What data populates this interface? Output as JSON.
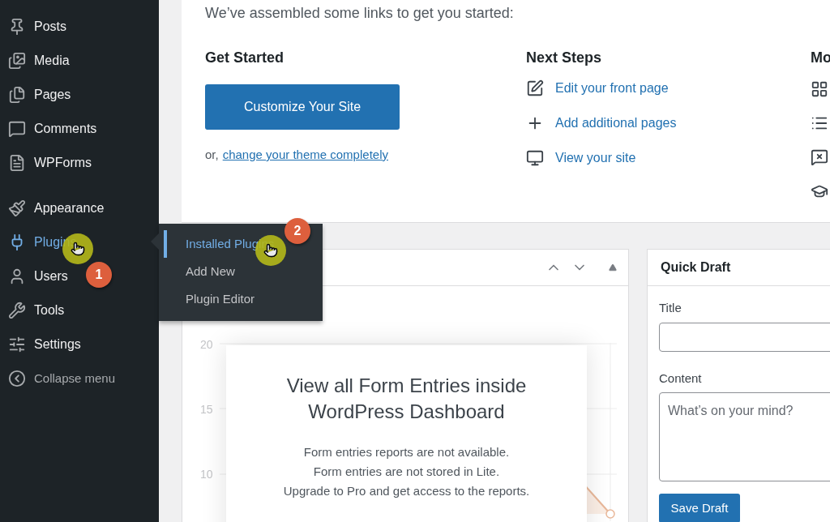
{
  "sidebar": {
    "sections": [
      {
        "items": [
          {
            "label": "Posts",
            "kind": "link",
            "selected": false
          },
          {
            "label": "Media",
            "kind": "link",
            "selected": false
          },
          {
            "label": "Pages",
            "kind": "link",
            "selected": false
          },
          {
            "label": "Comments",
            "kind": "link",
            "selected": false
          },
          {
            "label": "WPForms",
            "kind": "link",
            "selected": false
          }
        ]
      },
      {
        "items": [
          {
            "label": "Appearance",
            "kind": "link",
            "selected": false
          },
          {
            "label": "Plugins",
            "kind": "link",
            "selected": true
          },
          {
            "label": "Users",
            "kind": "link",
            "selected": false
          },
          {
            "label": "Tools",
            "kind": "link",
            "selected": false
          },
          {
            "label": "Settings",
            "kind": "link",
            "selected": false
          },
          {
            "label": "Collapse menu",
            "kind": "collapse",
            "selected": false
          }
        ]
      }
    ]
  },
  "flyout": {
    "items": [
      {
        "label": "Installed Plugins",
        "selected": true
      },
      {
        "label": "Add New",
        "selected": false
      },
      {
        "label": "Plugin Editor",
        "selected": false
      }
    ]
  },
  "welcome": {
    "intro": "We’ve assembled some links to get you started:",
    "get_started": {
      "heading": "Get Started",
      "button": "Customize Your Site",
      "alt_prefix": "or,",
      "alt_link": "change your theme completely"
    },
    "next_steps": {
      "heading": "Next Steps",
      "links": [
        {
          "label": "Edit your front page"
        },
        {
          "label": "Add additional pages"
        },
        {
          "label": "View your site"
        }
      ]
    },
    "more_actions": {
      "heading": "Mo"
    }
  },
  "forms_widget": {
    "y_tick_labels": [
      "20",
      "15",
      "10"
    ],
    "overlay": {
      "title": "View all Form Entries inside WordPress Dashboard",
      "lines": [
        "Form entries reports are not available.",
        "Form entries are not stored in Lite.",
        "Upgrade to Pro and get access to the reports."
      ]
    }
  },
  "quick_draft": {
    "title": "Quick Draft",
    "title_label": "Title",
    "content_label": "Content",
    "content_placeholder": "What’s on your mind?",
    "button": "Save Draft"
  },
  "annotations": [
    {
      "label": "1"
    },
    {
      "label": "2"
    }
  ]
}
